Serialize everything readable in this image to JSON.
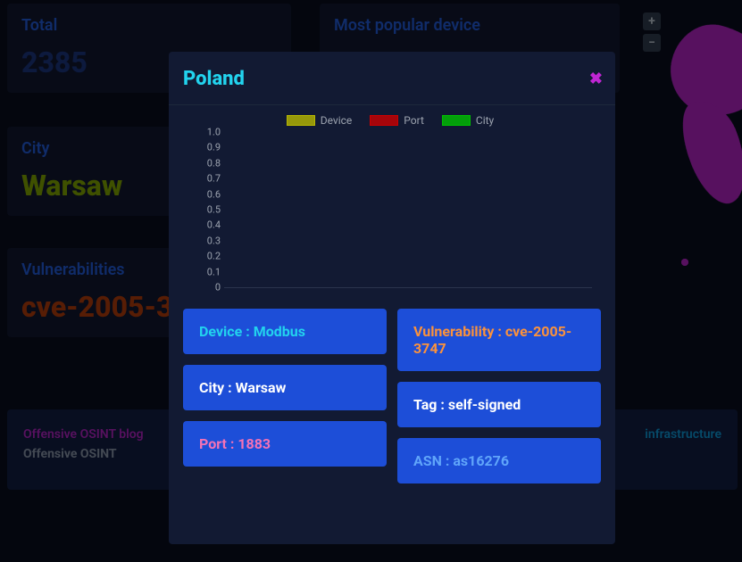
{
  "cards": {
    "total": {
      "title": "Total",
      "value": "2385"
    },
    "popular": {
      "title": "Most popular device"
    },
    "city": {
      "title": "City",
      "value": "Warsaw"
    },
    "vuln": {
      "title": "Vulnerabilities",
      "value": "cve-2005-3747"
    }
  },
  "zoom": {
    "in": "+",
    "out": "−"
  },
  "footer": {
    "left1": "Offensive OSINT blog",
    "left2": "Offensive OSINT",
    "right": "infrastructure"
  },
  "modal": {
    "title": "Poland",
    "close": "✖",
    "legend": [
      {
        "label": "Device",
        "swatch": "sw-device"
      },
      {
        "label": "Port",
        "swatch": "sw-port"
      },
      {
        "label": "City",
        "swatch": "sw-city"
      }
    ],
    "pills_left": [
      {
        "text": "Device : Modbus",
        "color": "c-cyan"
      },
      {
        "text": "City : Warsaw",
        "color": "pill-default"
      },
      {
        "text": "Port : 1883",
        "color": "c-pink"
      }
    ],
    "pills_right": [
      {
        "text": "Vulnerability : cve-2005-3747",
        "color": "c-orange"
      },
      {
        "text": "Tag : self-signed",
        "color": "pill-default"
      },
      {
        "text": "ASN : as16276",
        "color": "c-blue"
      }
    ]
  },
  "chart_data": {
    "type": "bar",
    "series": [
      {
        "name": "Device",
        "values": []
      },
      {
        "name": "Port",
        "values": []
      },
      {
        "name": "City",
        "values": []
      }
    ],
    "ylim": [
      0,
      1.0
    ],
    "yticks": [
      "1.0",
      "0.9",
      "0.8",
      "0.7",
      "0.6",
      "0.5",
      "0.4",
      "0.3",
      "0.2",
      "0.1",
      "0"
    ],
    "title": "",
    "xlabel": "",
    "ylabel": ""
  }
}
